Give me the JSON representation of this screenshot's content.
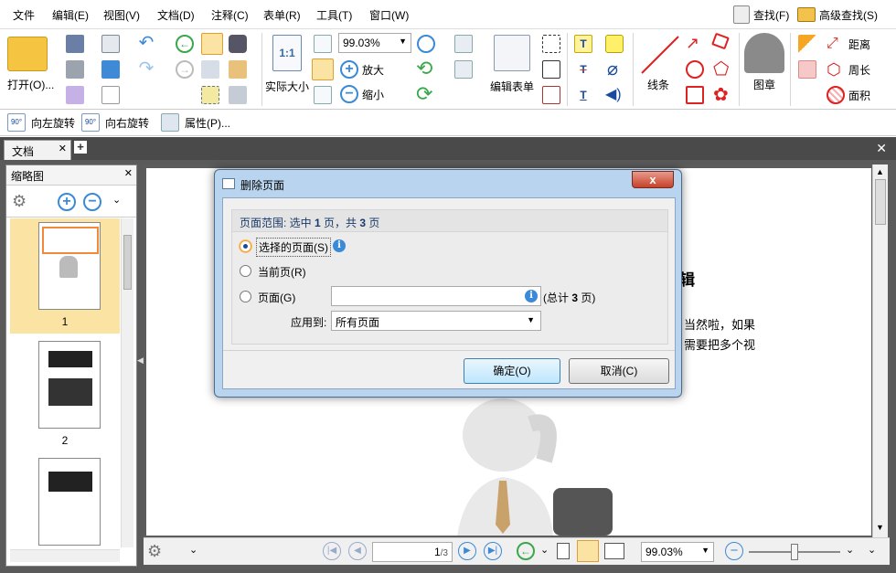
{
  "menu": {
    "items": [
      "文件",
      "编辑(E)",
      "视图(V)",
      "文档(D)",
      "注释(C)",
      "表单(R)",
      "工具(T)",
      "窗口(W)"
    ],
    "find": "查找(F)",
    "advanced_find": "高级查找(S)"
  },
  "ribbon": {
    "open": "打开(O)...",
    "actual_size": "实际大小",
    "zoom_value": "99.03%",
    "zoom_in": "放大",
    "zoom_out": "缩小",
    "edit_form": "编辑表单",
    "lines": "线条",
    "stamp": "图章",
    "distance": "距离",
    "perimeter": "周长",
    "area": "面积"
  },
  "toolbar2": {
    "rotate_left": "向左旋转",
    "rotate_right": "向右旋转",
    "properties": "属性(P)...",
    "rotate_badge": "90°"
  },
  "tabs": {
    "doc_tab": "文档"
  },
  "thumbs": {
    "title": "缩略图",
    "pages": [
      "1",
      "2"
    ]
  },
  "page": {
    "heading_frag": "辑",
    "line1": "当然啦，如果",
    "line2": "需要把多个视"
  },
  "status": {
    "page_input": "1",
    "page_total": "/3",
    "zoom": "99.03%"
  },
  "dialog": {
    "title": "删除页面",
    "range_prefix": "页面范围: 选中 ",
    "range_sel": "1",
    "range_mid": " 页，共 ",
    "range_total": "3",
    "range_suffix": " 页",
    "opt_selected": "选择的页面(S)",
    "opt_current": "当前页(R)",
    "opt_pages": "页面(G)",
    "pages_value": "",
    "total_prefix": "(总计 ",
    "total_count": "3",
    "total_suffix": " 页)",
    "apply_label": "应用到:",
    "apply_value": "所有页面",
    "ok": "确定(O)",
    "cancel": "取消(C)",
    "close_glyph": "x",
    "info_glyph": "i"
  },
  "colors": {
    "accent": "#3c7fb1",
    "dialog_frame": "#b9d4ee",
    "close_red": "#c6412b",
    "dark_bg": "#5a5a5a",
    "selected_thumb": "#fbe3a4"
  }
}
